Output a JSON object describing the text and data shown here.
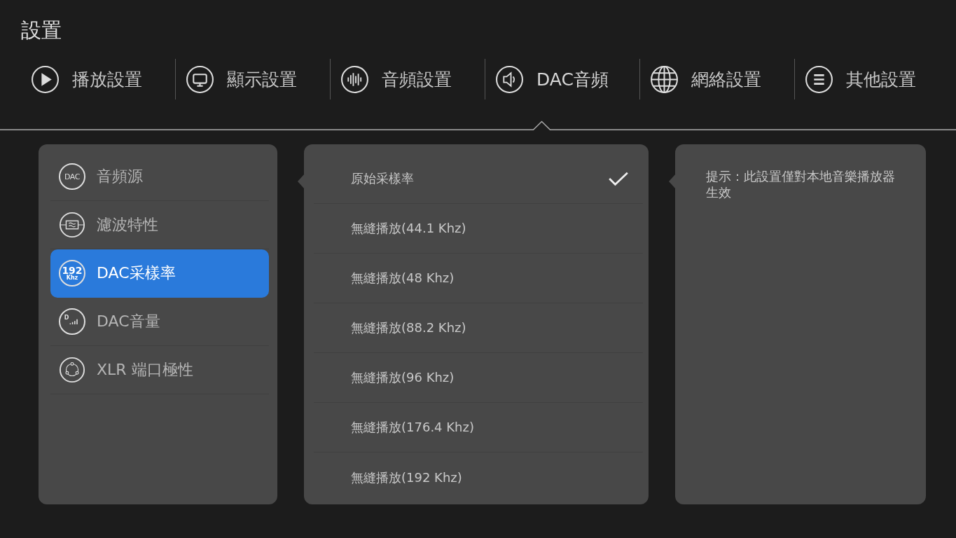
{
  "title": "設置",
  "tabs": [
    {
      "label": "播放設置",
      "kind": "play",
      "selected": false
    },
    {
      "label": "顯示設置",
      "kind": "display",
      "selected": false
    },
    {
      "label": "音頻設置",
      "kind": "audio",
      "selected": false
    },
    {
      "label": "DAC音頻",
      "kind": "speaker",
      "selected": true
    },
    {
      "label": "網絡設置",
      "kind": "globe",
      "selected": false
    },
    {
      "label": "其他設置",
      "kind": "menu",
      "selected": false
    }
  ],
  "sidebar": {
    "items": [
      {
        "label": "音頻源",
        "kind": "dac",
        "icon_text": [
          "DAC"
        ],
        "selected": false
      },
      {
        "label": "濾波特性",
        "kind": "filter",
        "selected": false
      },
      {
        "label": "DAC采樣率",
        "kind": "rate",
        "icon_text": [
          "192",
          "Khz"
        ],
        "selected": true
      },
      {
        "label": "DAC音量",
        "kind": "volume",
        "icon_text": [
          "D"
        ],
        "selected": false
      },
      {
        "label": "XLR 端口極性",
        "kind": "xlr",
        "selected": false
      }
    ]
  },
  "options": [
    {
      "label": "原始采樣率",
      "selected": true
    },
    {
      "label": "無縫播放(44.1 Khz)",
      "selected": false
    },
    {
      "label": "無縫播放(48 Khz)",
      "selected": false
    },
    {
      "label": "無縫播放(88.2 Khz)",
      "selected": false
    },
    {
      "label": "無縫播放(96 Khz)",
      "selected": false
    },
    {
      "label": "無縫播放(176.4 Khz)",
      "selected": false
    },
    {
      "label": "無縫播放(192 Khz)",
      "selected": false
    }
  ],
  "hint": "提示：此設置僅對本地音樂播放器生效"
}
